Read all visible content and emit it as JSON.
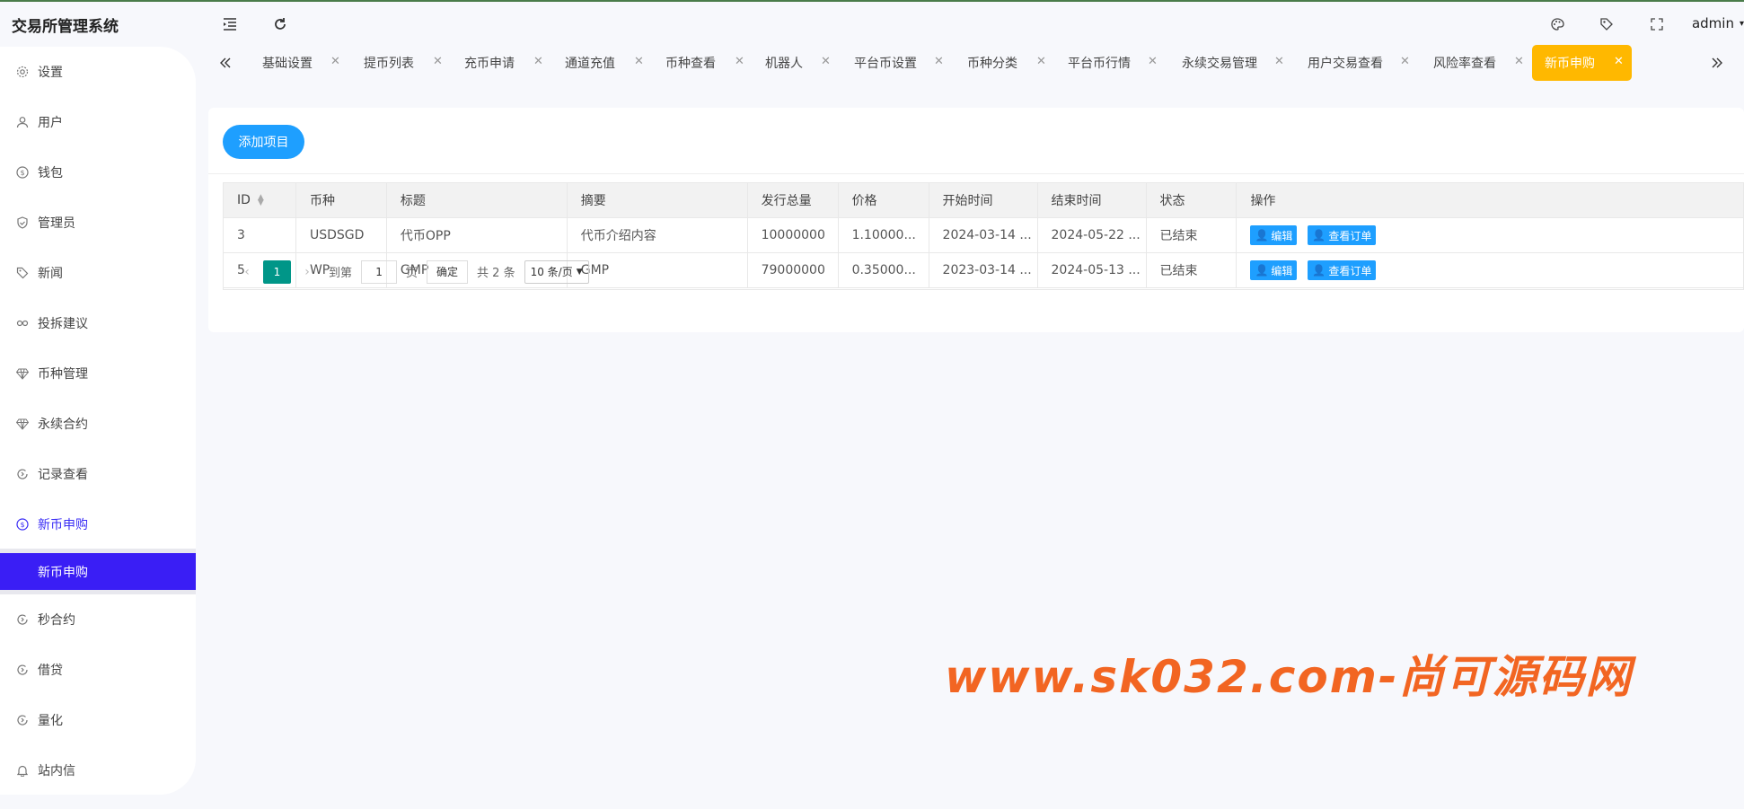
{
  "app": {
    "title": "交易所管理系统",
    "user": "admin"
  },
  "icons": {
    "menu_toggle": "menu-fold-icon",
    "refresh": "refresh-icon",
    "theme": "palette-icon",
    "tag": "tag-icon",
    "fullscreen": "fullscreen-icon"
  },
  "sidebar": {
    "items": [
      {
        "label": "设置",
        "icon": "gear-icon"
      },
      {
        "label": "用户",
        "icon": "user-icon"
      },
      {
        "label": "钱包",
        "icon": "dollar-icon"
      },
      {
        "label": "管理员",
        "icon": "shield-icon"
      },
      {
        "label": "新闻",
        "icon": "tag-icon"
      },
      {
        "label": "投拆建议",
        "icon": "link-icon"
      },
      {
        "label": "币种管理",
        "icon": "diamond-icon"
      },
      {
        "label": "永续合约",
        "icon": "diamond-icon"
      },
      {
        "label": "记录查看",
        "icon": "circle-arrow-icon"
      },
      {
        "label": "新币申购",
        "icon": "dollar-icon"
      },
      {
        "label": "秒合约",
        "icon": "circle-arrow-icon"
      },
      {
        "label": "借贷",
        "icon": "circle-arrow-icon"
      },
      {
        "label": "量化",
        "icon": "circle-arrow-icon"
      },
      {
        "label": "站内信",
        "icon": "bell-icon"
      }
    ],
    "active_sub": "新币申购"
  },
  "tabs": [
    "基础设置",
    "提币列表",
    "充币申请",
    "通道充值",
    "币种查看",
    "机器人",
    "平台币设置",
    "币种分类",
    "平台币行情",
    "永续交易管理",
    "用户交易查看",
    "风险率查看",
    "新币申购"
  ],
  "active_tab": "新币申购",
  "toolbar": {
    "add_label": "添加项目"
  },
  "table": {
    "headers": [
      "ID",
      "币种",
      "标题",
      "摘要",
      "发行总量",
      "价格",
      "开始时间",
      "结束时间",
      "状态",
      "操作"
    ],
    "rows": [
      {
        "id": "3",
        "coin": "USDSGD",
        "title": "代币OPP",
        "summary": "代币介绍内容",
        "supply": "10000000",
        "price": "1.10000...",
        "start": "2024-03-14 ...",
        "end": "2024-05-22 ...",
        "status": "已结束"
      },
      {
        "id": "5",
        "coin": "WP",
        "title": "GMP",
        "summary": "GMP",
        "supply": "79000000",
        "price": "0.35000...",
        "start": "2023-03-14 ...",
        "end": "2024-05-13 ...",
        "status": "已结束"
      }
    ],
    "op_edit": "编辑",
    "op_orders": "查看订单"
  },
  "pager": {
    "current": "1",
    "goto_label": "到第",
    "goto_value": "1",
    "page_unit": "页",
    "confirm": "确定",
    "total": "共 2 条",
    "page_size": "10 条/页"
  },
  "watermark": "www.sk032.com-尚可源码网",
  "colors": {
    "primary": "#1e9fff",
    "active_tab": "#ffb800",
    "active_nav": "#3a1ef5",
    "pager_current": "#009688",
    "status_ended": "#ff0000",
    "watermark": "#f26522"
  }
}
